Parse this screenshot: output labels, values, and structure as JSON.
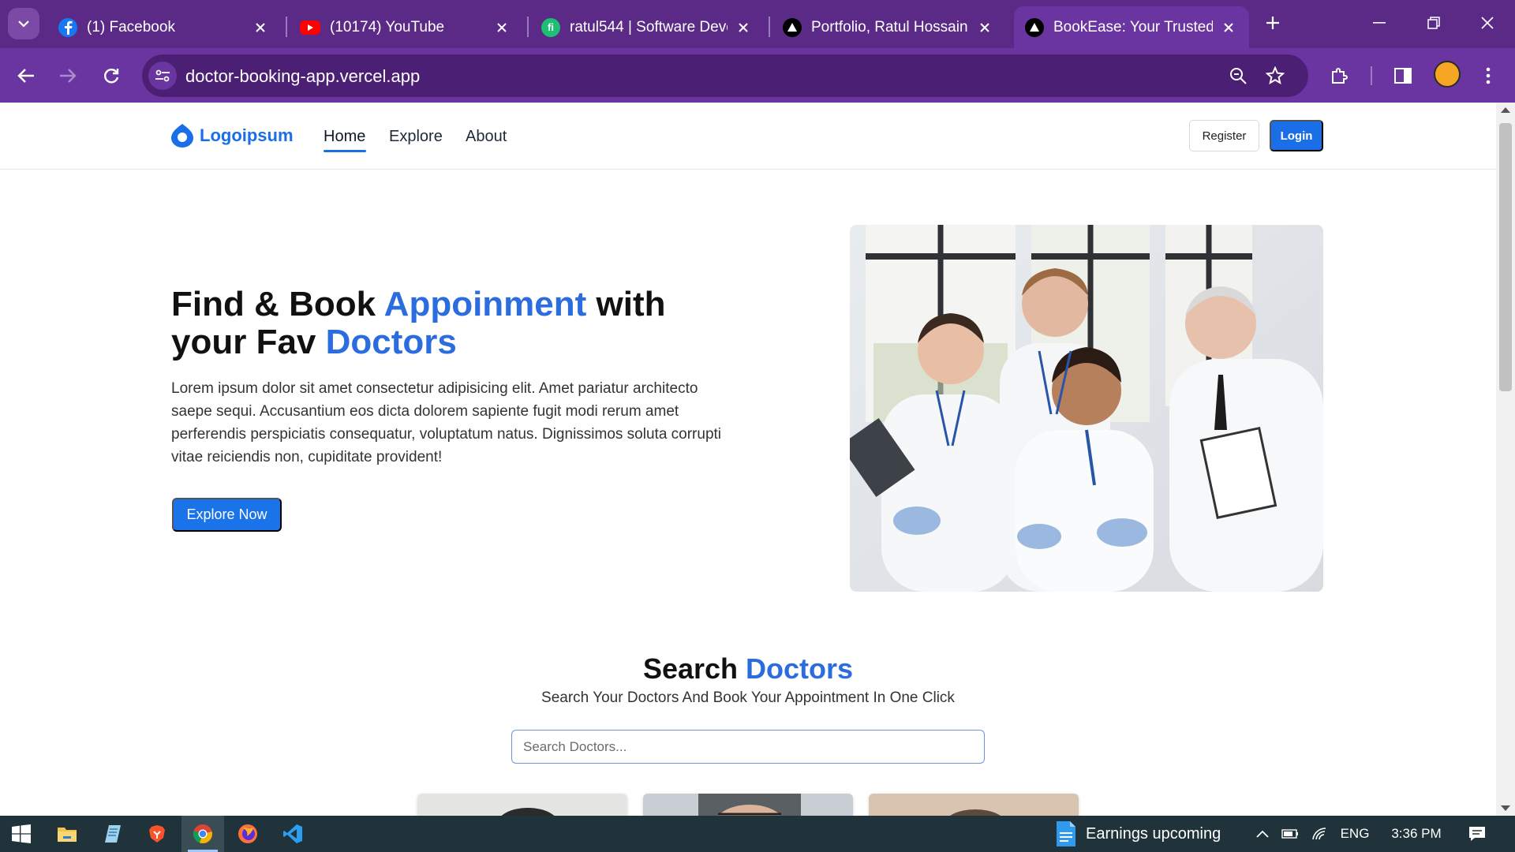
{
  "browser": {
    "tabs": [
      {
        "title": "(1) Facebook",
        "icon": "facebook-icon",
        "active": false
      },
      {
        "title": "(10174) YouTube",
        "icon": "youtube-icon",
        "active": false
      },
      {
        "title": "ratul544 | Software Devel",
        "icon": "fiverr-icon",
        "active": false
      },
      {
        "title": "Portfolio, Ratul Hossain",
        "icon": "vercel-icon",
        "active": false
      },
      {
        "title": "BookEase: Your Trusted D",
        "icon": "vercel-icon",
        "active": true
      }
    ],
    "url": "doctor-booking-app.vercel.app"
  },
  "site": {
    "logo_text": "Logoipsum",
    "nav": [
      "Home",
      "Explore",
      "About"
    ],
    "register_label": "Register",
    "login_label": "Login"
  },
  "hero": {
    "title_part1": "Find & Book ",
    "title_hl1": "Appoinment",
    "title_part2": " with your Fav ",
    "title_hl2": "Doctors",
    "description": "Lorem ipsum dolor sit amet consectetur adipisicing elit. Amet pariatur architecto saepe sequi. Accusantium eos dicta dolorem sapiente fugit modi rerum amet perferendis perspiciatis consequatur, voluptatum natus. Dignissimos soluta corrupti vitae reiciendis non, cupiditate provident!",
    "cta_label": "Explore Now"
  },
  "search": {
    "title_part1": "Search ",
    "title_hl": "Doctors",
    "subtitle": "Search Your Doctors And Book Your Appointment In One Click",
    "placeholder": "Search Doctors..."
  },
  "taskbar": {
    "news": "Earnings upcoming",
    "language": "ENG",
    "time": "3:36 PM"
  },
  "colors": {
    "accent": "#1a6ee8",
    "highlight": "#2b6cdf",
    "browser_frame": "#6a35a0",
    "taskbar": "#20333a"
  }
}
